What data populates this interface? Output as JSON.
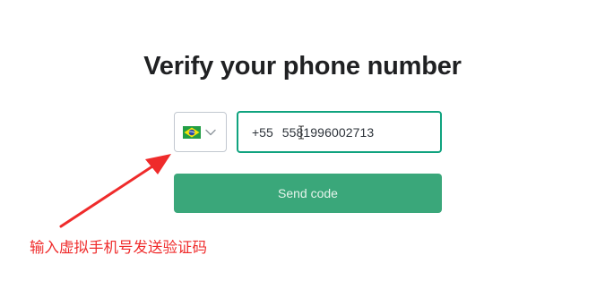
{
  "page": {
    "title": "Verify your phone number"
  },
  "country_select": {
    "flag_icon": "brazil-flag-icon",
    "chevron_icon": "chevron-down-icon",
    "selected_country": "Brazil"
  },
  "phone_input": {
    "dial_code": "+55",
    "number": "5581996002713"
  },
  "send_button": {
    "label": "Send code"
  },
  "annotation": {
    "text": "输入虚拟手机号发送验证码",
    "color": "#ef2b2b"
  },
  "colors": {
    "accent": "#10a37f",
    "button_bg": "#3aa77a",
    "title": "#202123"
  }
}
